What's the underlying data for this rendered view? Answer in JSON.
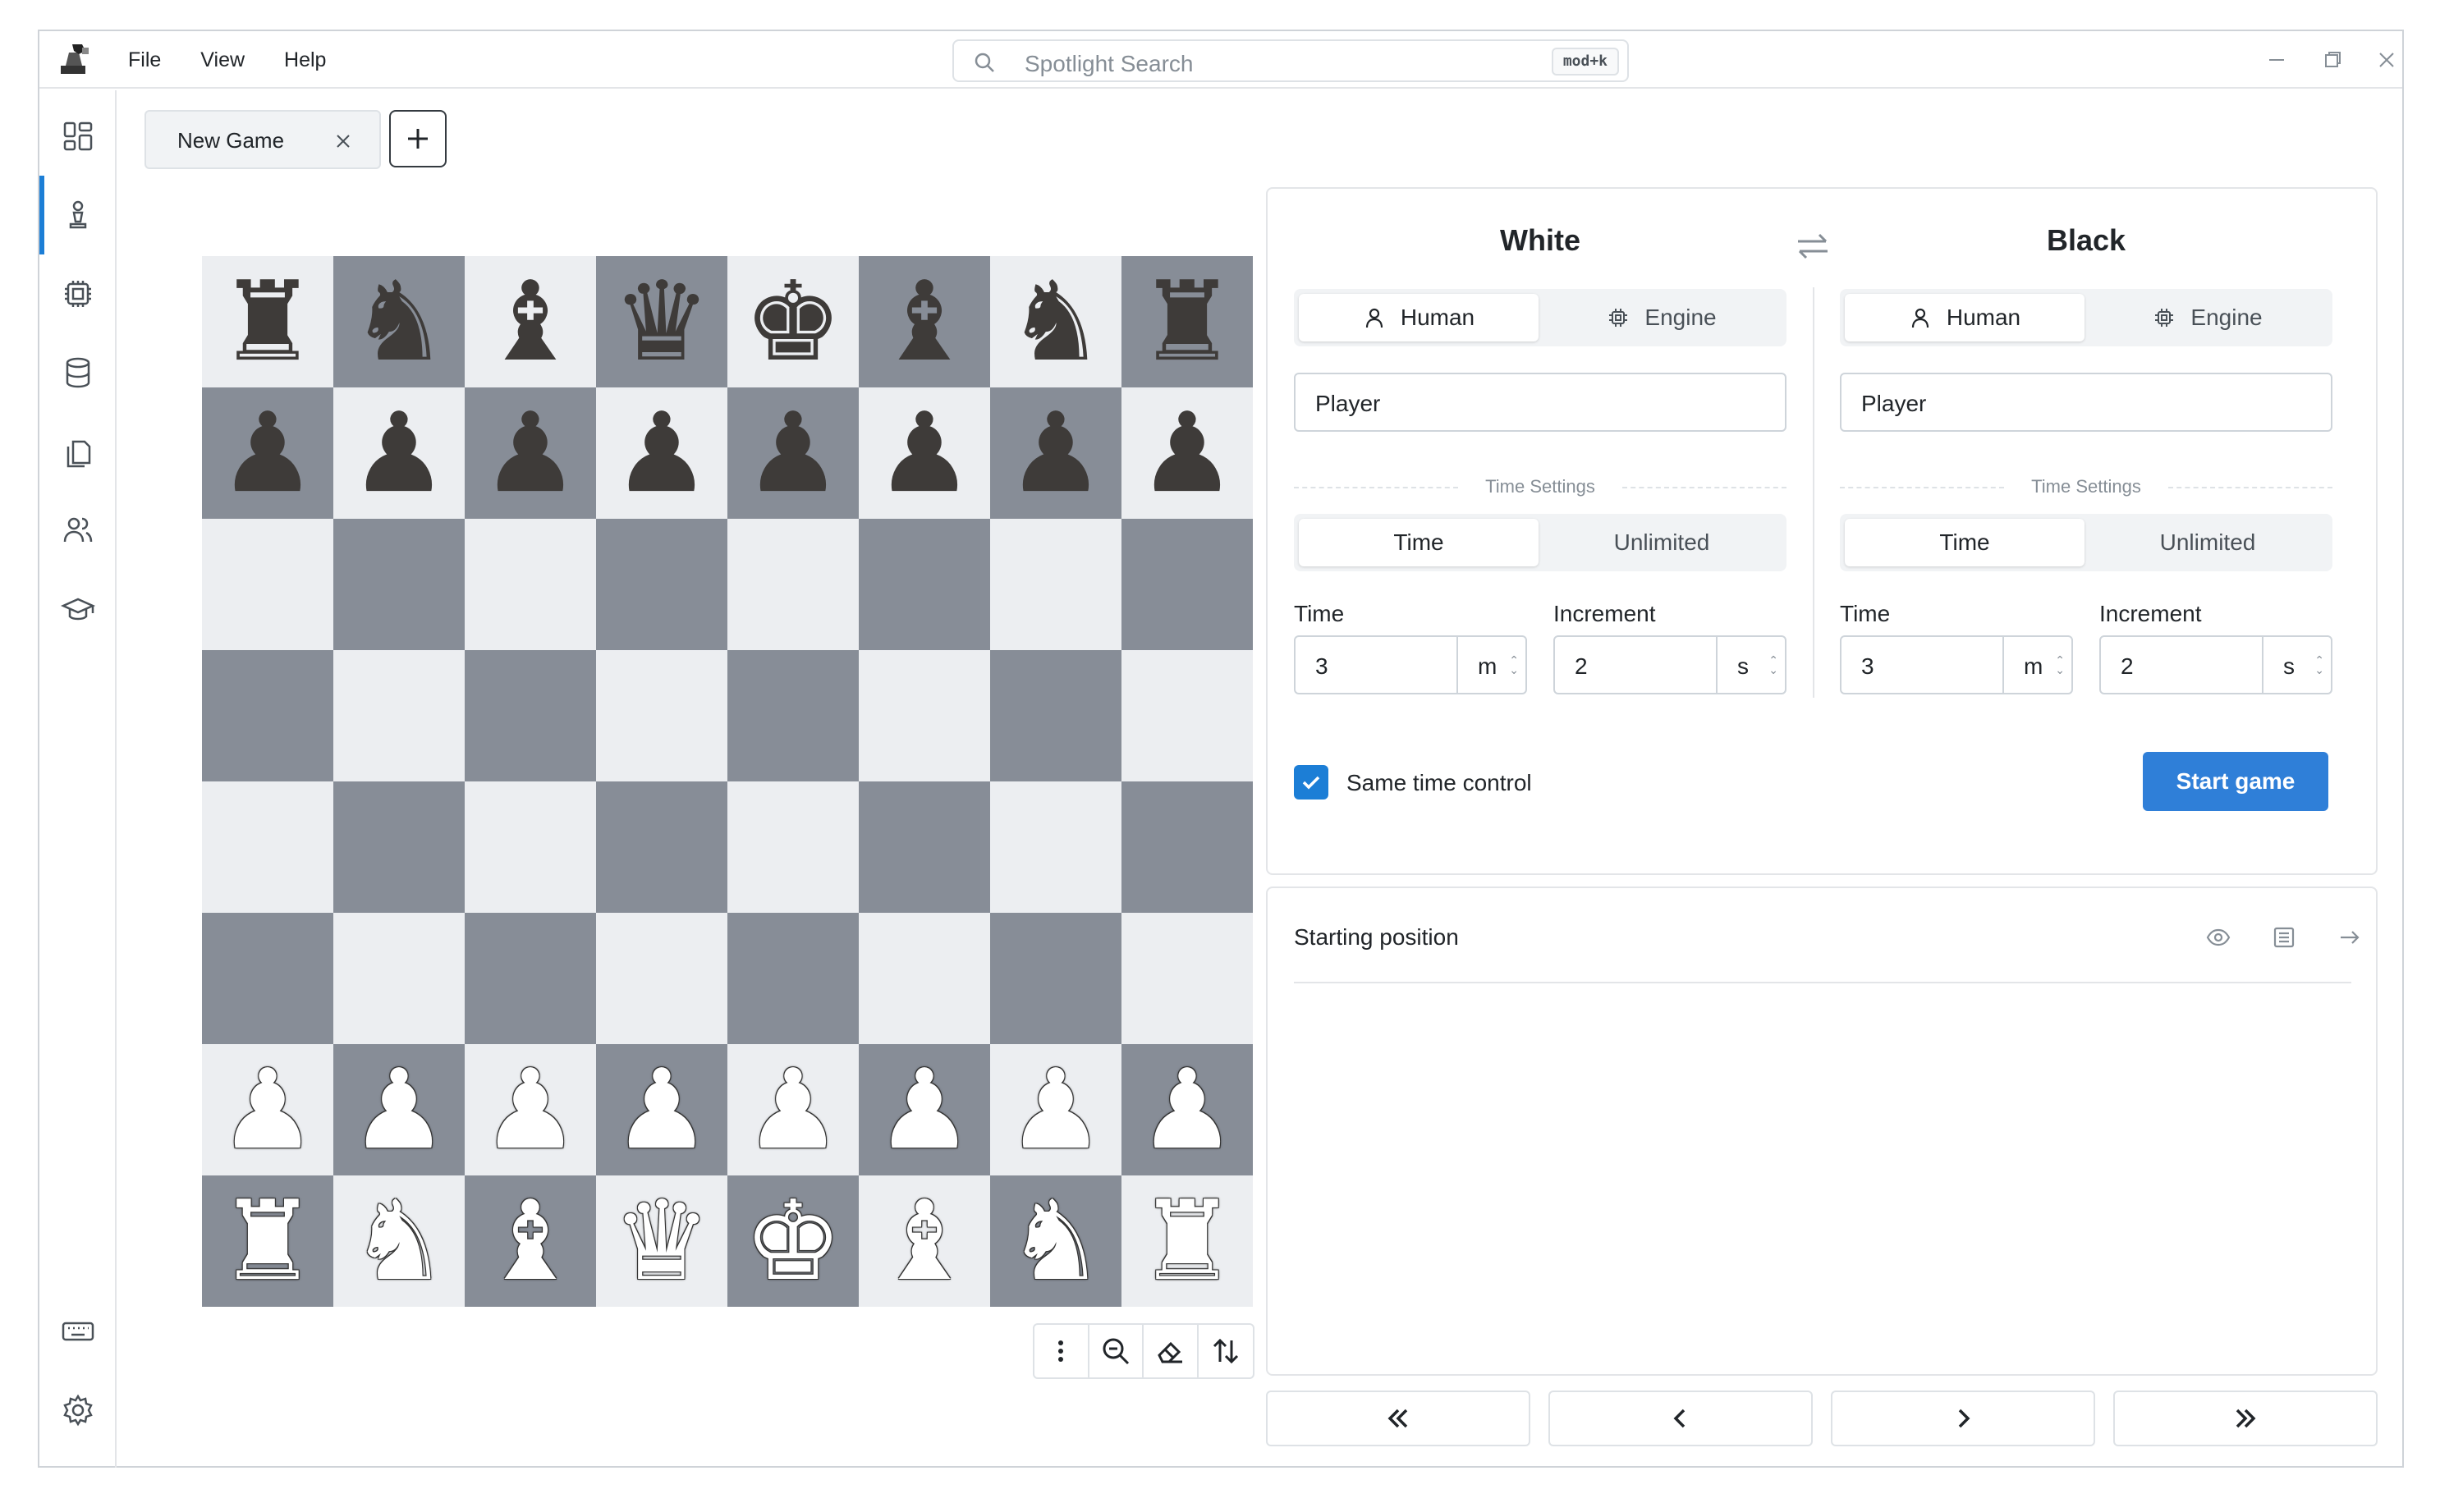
{
  "menu": {
    "file": "File",
    "view": "View",
    "help": "Help"
  },
  "search": {
    "placeholder": "Spotlight Search",
    "shortcut": "mod+k"
  },
  "tabs": [
    {
      "label": "New Game"
    }
  ],
  "board": {
    "rows": [
      [
        "♜",
        "♞",
        "♝",
        "♛",
        "♚",
        "♝",
        "♞",
        "♜"
      ],
      [
        "♟",
        "♟",
        "♟",
        "♟",
        "♟",
        "♟",
        "♟",
        "♟"
      ],
      [
        "",
        "",
        "",
        "",
        "",
        "",
        "",
        ""
      ],
      [
        "",
        "",
        "",
        "",
        "",
        "",
        "",
        ""
      ],
      [
        "",
        "",
        "",
        "",
        "",
        "",
        "",
        ""
      ],
      [
        "",
        "",
        "",
        "",
        "",
        "",
        "",
        ""
      ],
      [
        "♟",
        "♟",
        "♟",
        "♟",
        "♟",
        "♟",
        "♟",
        "♟"
      ],
      [
        "♜",
        "♞",
        "♝",
        "♛",
        "♚",
        "♝",
        "♞",
        "♜"
      ]
    ],
    "colors": [
      "b",
      "b",
      "",
      "",
      "",
      "",
      "w",
      "w"
    ]
  },
  "white": {
    "title": "White",
    "player_type": {
      "human": "Human",
      "engine": "Engine",
      "selected": "human"
    },
    "name": "Player",
    "time_settings_label": "Time Settings",
    "time_mode": {
      "time": "Time",
      "unlimited": "Unlimited",
      "selected": "time"
    },
    "time_label": "Time",
    "time_value": "3",
    "time_unit": "m",
    "increment_label": "Increment",
    "increment_value": "2",
    "increment_unit": "s"
  },
  "black": {
    "title": "Black",
    "player_type": {
      "human": "Human",
      "engine": "Engine",
      "selected": "human"
    },
    "name": "Player",
    "time_settings_label": "Time Settings",
    "time_mode": {
      "time": "Time",
      "unlimited": "Unlimited",
      "selected": "time"
    },
    "time_label": "Time",
    "time_value": "3",
    "time_unit": "m",
    "increment_label": "Increment",
    "increment_value": "2",
    "increment_unit": "s"
  },
  "same_time_control": {
    "label": "Same time control",
    "checked": true
  },
  "start_button": "Start game",
  "moves": {
    "title": "Starting position"
  },
  "colors": {
    "accent": "#2f7fd8",
    "dark_square": "#878d97",
    "light_square": "#eceef1"
  }
}
